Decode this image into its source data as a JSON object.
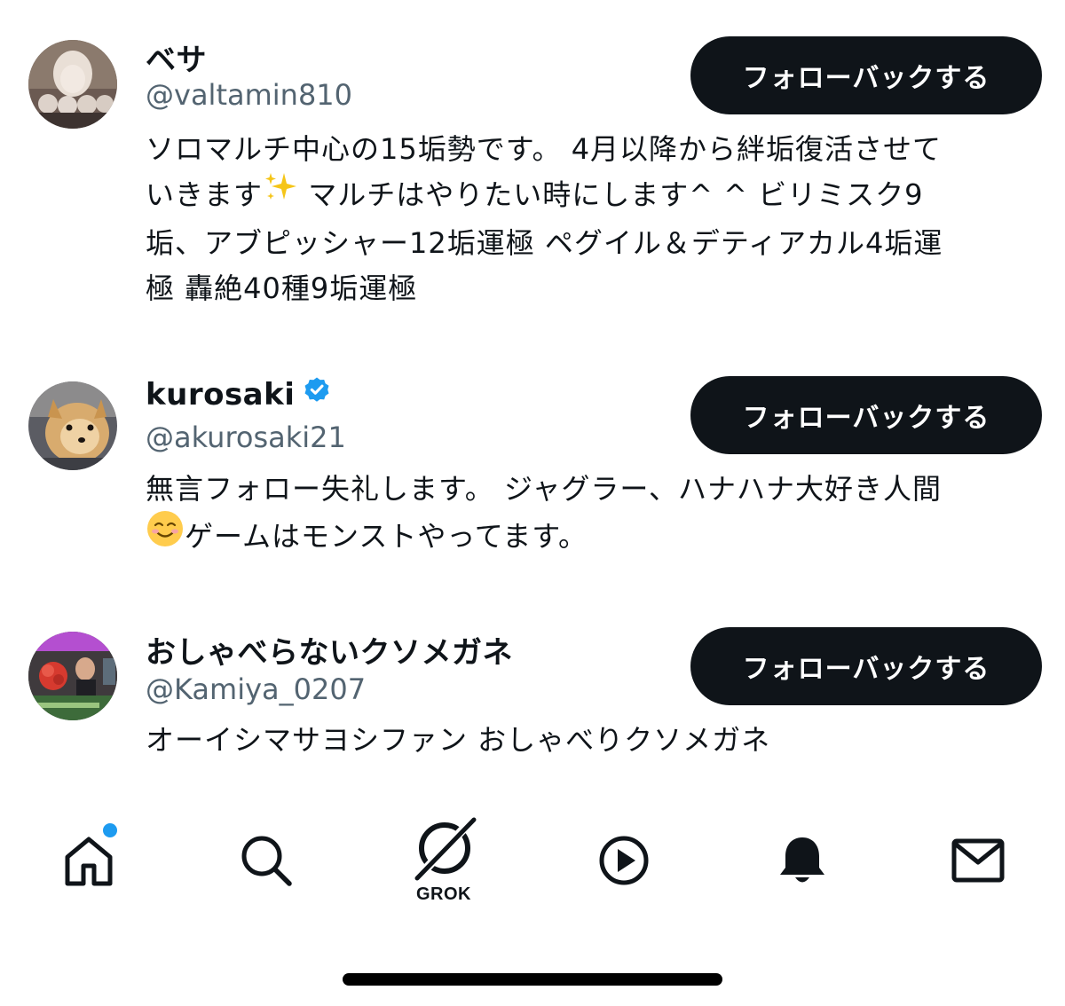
{
  "users": [
    {
      "display_name": "ベサ",
      "handle": "@valtamin810",
      "verified": false,
      "bio_lines": [
        "ソロマルチ中心の15垢勢です。 4月以降から絆垢復活させて",
        "いきます",
        " マルチはやりたい時にします^ ^ ビリミスク9",
        "垢、アブピッシャー12垢運極 ペグイル＆デティアカル4垢運",
        "極 轟絶40種9垢運極"
      ],
      "follow_label": "フォローバックする"
    },
    {
      "display_name": "kurosaki",
      "handle": "@akurosaki21",
      "verified": true,
      "bio_lines": [
        "無言フォロー失礼します。 ジャグラー、ハナハナ大好き人間",
        "ゲームはモンストやってます。"
      ],
      "follow_label": "フォローバックする"
    },
    {
      "display_name": "おしゃべらないクソメガネ",
      "handle": "@Kamiya_0207",
      "verified": false,
      "bio_lines": [
        "オーイシマサヨシファン おしゃべりクソメガネ"
      ],
      "follow_label": "フォローバックする"
    }
  ],
  "nav": {
    "items": [
      {
        "icon": "home-icon",
        "has_badge": true
      },
      {
        "icon": "search-icon"
      },
      {
        "icon": "grok-icon",
        "label": "GROK"
      },
      {
        "icon": "video-play-icon"
      },
      {
        "icon": "bell-icon"
      },
      {
        "icon": "mail-icon"
      }
    ]
  },
  "colors": {
    "text": "#0f1419",
    "secondary": "#536471",
    "button_bg": "#0f1419",
    "verified": "#1d9bf0",
    "badge": "#1d9bf0"
  }
}
